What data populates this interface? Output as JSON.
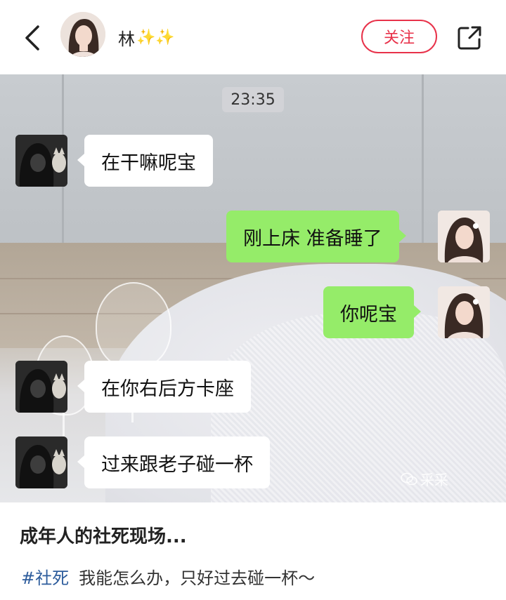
{
  "header": {
    "username": "林",
    "sparkles": "✨✨",
    "follow_label": "关注",
    "icons": {
      "back": "back-arrow-icon",
      "share": "share-icon"
    },
    "accent_color": "#e8324a"
  },
  "chat": {
    "timestamp": "23:35",
    "messages": [
      {
        "side": "left",
        "text": "在干嘛呢宝"
      },
      {
        "side": "right",
        "text": "刚上床 准备睡了"
      },
      {
        "side": "right",
        "text": "你呢宝"
      },
      {
        "side": "left",
        "text": "在你右后方卡座"
      },
      {
        "side": "left",
        "text": "过来跟老子碰一杯"
      }
    ],
    "bubble_colors": {
      "left": "#ffffff",
      "right": "#95ec69"
    },
    "watermark": "采采"
  },
  "post": {
    "title": "成年人的社死现场...",
    "hashtag": "#社死",
    "description": "我能怎么办，只好过去碰一杯～"
  }
}
